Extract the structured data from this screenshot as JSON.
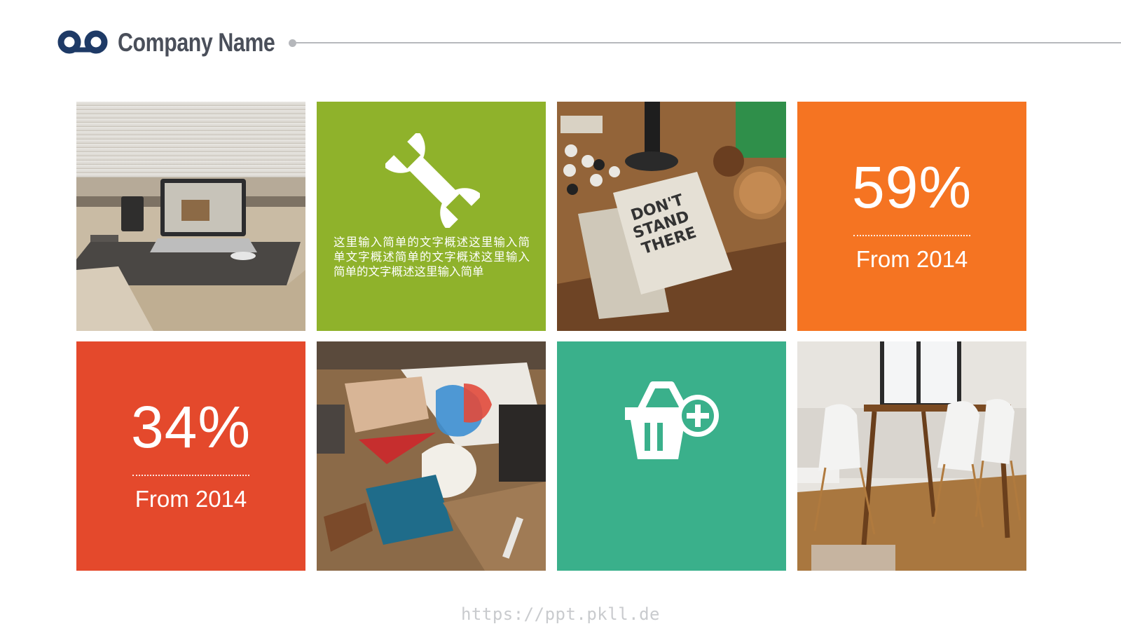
{
  "header": {
    "company_name": "Company Name",
    "logo_icon": "voicemail-icon",
    "brand_color": "#1e3a66"
  },
  "tiles": {
    "t1": {
      "kind": "photo",
      "icon": "laptop-desk-photo"
    },
    "t2": {
      "kind": "text",
      "icon": "wrench-icon",
      "color": "#8fb22b",
      "description": "这里输入简单的文字概述这里输入简单文字概述简单的文字概述这里输入简单的文字概述这里输入简单"
    },
    "t3": {
      "kind": "photo",
      "icon": "notebook-desk-photo"
    },
    "t4": {
      "kind": "stat",
      "color": "#f57422",
      "value": "59%",
      "subtitle": "From 2014"
    },
    "t5": {
      "kind": "stat",
      "color": "#e4492c",
      "value": "34%",
      "subtitle": "From 2014"
    },
    "t6": {
      "kind": "photo",
      "icon": "flatlay-table-photo"
    },
    "t7": {
      "kind": "icon",
      "icon": "basket-add-icon",
      "color": "#3ab08b"
    },
    "t8": {
      "kind": "photo",
      "icon": "dining-room-photo"
    }
  },
  "footer": {
    "watermark": "https://ppt.pkll.de"
  }
}
